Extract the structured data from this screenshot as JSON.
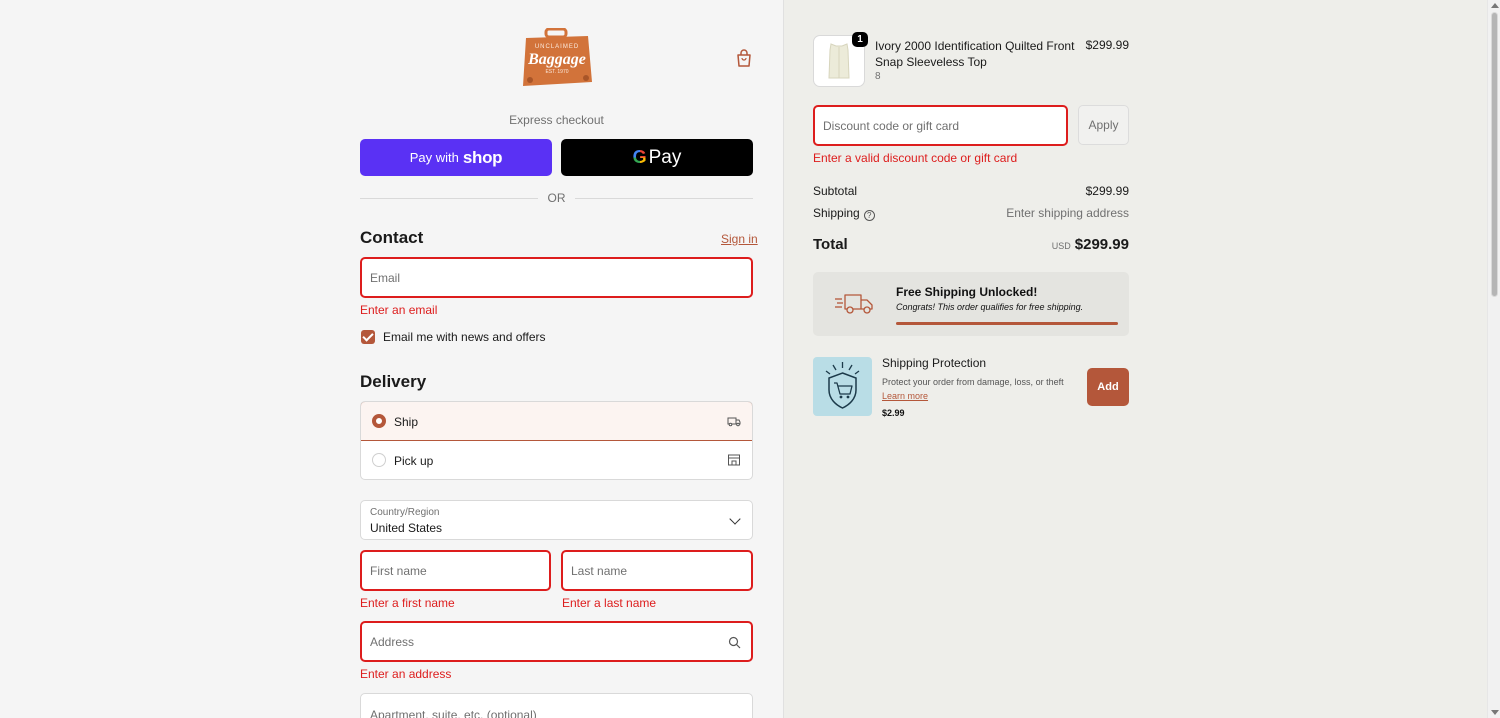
{
  "header": {
    "logo_top_text": "UNCLAIMED",
    "logo_main_text": "Baggage",
    "logo_est_text": "EST. 1970",
    "logo_color": "#d2733a",
    "cart_icon": "shopping-bag-icon"
  },
  "express": {
    "label": "Express checkout",
    "shop_pay_prefix": "Pay with",
    "shop_pay_brand": "shop",
    "gpay_g": "G",
    "gpay_label": "Pay",
    "or_label": "OR"
  },
  "contact": {
    "heading": "Contact",
    "sign_in": "Sign in",
    "email_placeholder": "Email",
    "email_error": "Enter an email",
    "newsletter_label": "Email me with news and offers",
    "newsletter_checked": true
  },
  "delivery": {
    "heading": "Delivery",
    "options": [
      {
        "label": "Ship",
        "selected": true,
        "icon": "truck-icon"
      },
      {
        "label": "Pick up",
        "selected": false,
        "icon": "store-icon"
      }
    ],
    "country_label": "Country/Region",
    "country_value": "United States",
    "first_name_placeholder": "First name",
    "first_name_error": "Enter a first name",
    "last_name_placeholder": "Last name",
    "last_name_error": "Enter a last name",
    "address_placeholder": "Address",
    "address_error": "Enter an address",
    "apartment_placeholder": "Apartment, suite, etc. (optional)"
  },
  "summary": {
    "item": {
      "quantity": "1",
      "name": "Ivory 2000 Identification Quilted Front Snap Sleeveless Top",
      "variant": "8",
      "price": "$299.99"
    },
    "discount_placeholder": "Discount code or gift card",
    "discount_error": "Enter a valid discount code or gift card",
    "apply_label": "Apply",
    "subtotal_label": "Subtotal",
    "subtotal_value": "$299.99",
    "shipping_label": "Shipping",
    "shipping_value": "Enter shipping address",
    "total_label": "Total",
    "total_currency": "USD",
    "total_value": "$299.99"
  },
  "free_shipping": {
    "title": "Free Shipping Unlocked!",
    "subtitle": "Congrats! This order qualifies for free shipping.",
    "progress": 1.0
  },
  "protection": {
    "title": "Shipping Protection",
    "description": "Protect your order from damage, loss, or theft",
    "learn_more": "Learn more",
    "price": "$2.99",
    "add_label": "Add"
  },
  "colors": {
    "accent": "#b4573a",
    "error": "#dd1d1d",
    "shop_pay": "#5a31f4"
  }
}
